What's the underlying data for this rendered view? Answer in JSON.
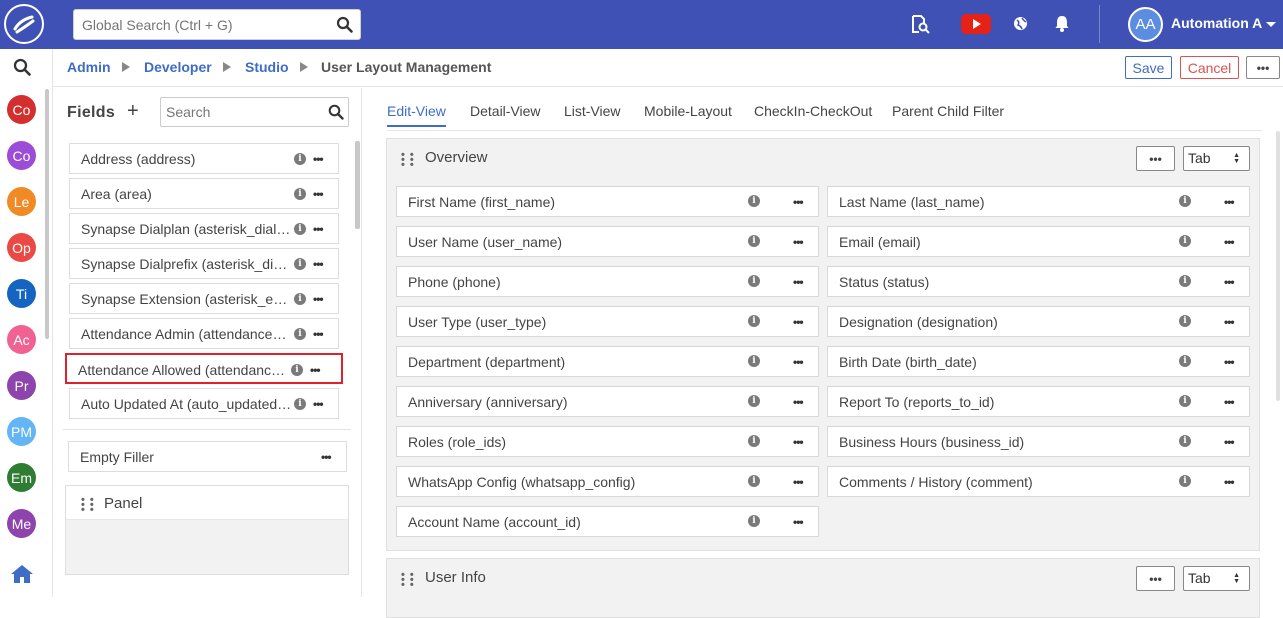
{
  "topbar": {
    "search_placeholder": "Global Search (Ctrl + G)",
    "avatar_initials": "AA",
    "user_name": "Automation A",
    "colors": {
      "bar": "#3f51b5",
      "youtube": "#e62117"
    }
  },
  "leftbar": {
    "modules": [
      {
        "label": "Co",
        "color": "#d32f2f"
      },
      {
        "label": "Co",
        "color": "#9c4dd8"
      },
      {
        "label": "Le",
        "color": "#f08a24"
      },
      {
        "label": "Op",
        "color": "#ea4a43"
      },
      {
        "label": "Ti",
        "color": "#1565c0"
      },
      {
        "label": "Ac",
        "color": "#f06292"
      },
      {
        "label": "Pr",
        "color": "#8e44ad"
      },
      {
        "label": "PM",
        "color": "#64b5f6"
      },
      {
        "label": "Em",
        "color": "#2e7d32"
      },
      {
        "label": "Me",
        "color": "#8e44ad"
      }
    ]
  },
  "breadcrumb": {
    "items": [
      "Admin",
      "Developer",
      "Studio"
    ],
    "current": "User Layout Management"
  },
  "actions": {
    "save": "Save",
    "cancel": "Cancel",
    "more": "•••"
  },
  "fields_panel": {
    "title": "Fields",
    "add": "+",
    "search_placeholder": "Search",
    "items": [
      "Address (address)",
      "Area (area)",
      "Synapse Dialplan (asterisk_dialplan)",
      "Synapse Dialprefix (asterisk_dialprefix)",
      "Synapse Extension (asterisk_extension)",
      "Attendance Admin (attendance_admin)",
      "Attendance Allowed (attendance_allowed)",
      "Auto Updated At (auto_updated_at)"
    ],
    "selected_index": 6,
    "empty_filler": "Empty Filler",
    "panel_label": "Panel"
  },
  "tabs": [
    "Edit-View",
    "Detail-View",
    "List-View",
    "Mobile-Layout",
    "CheckIn-CheckOut",
    "Parent Child Filter"
  ],
  "active_tab": "Edit-View",
  "sections": [
    {
      "title": "Overview",
      "type_value": "Tab",
      "left_fields": [
        "First Name (first_name)",
        "User Name (user_name)",
        "Phone (phone)",
        "User Type (user_type)",
        "Department (department)",
        "Anniversary (anniversary)",
        "Roles (role_ids)",
        "WhatsApp Config (whatsapp_config)",
        "Account Name (account_id)"
      ],
      "right_fields": [
        "Last Name (last_name)",
        "Email (email)",
        "Status (status)",
        "Designation (designation)",
        "Birth Date (birth_date)",
        "Report To (reports_to_id)",
        "Business Hours (business_id)",
        "Comments / History (comment)"
      ]
    },
    {
      "title": "User Info",
      "type_value": "Tab"
    }
  ]
}
